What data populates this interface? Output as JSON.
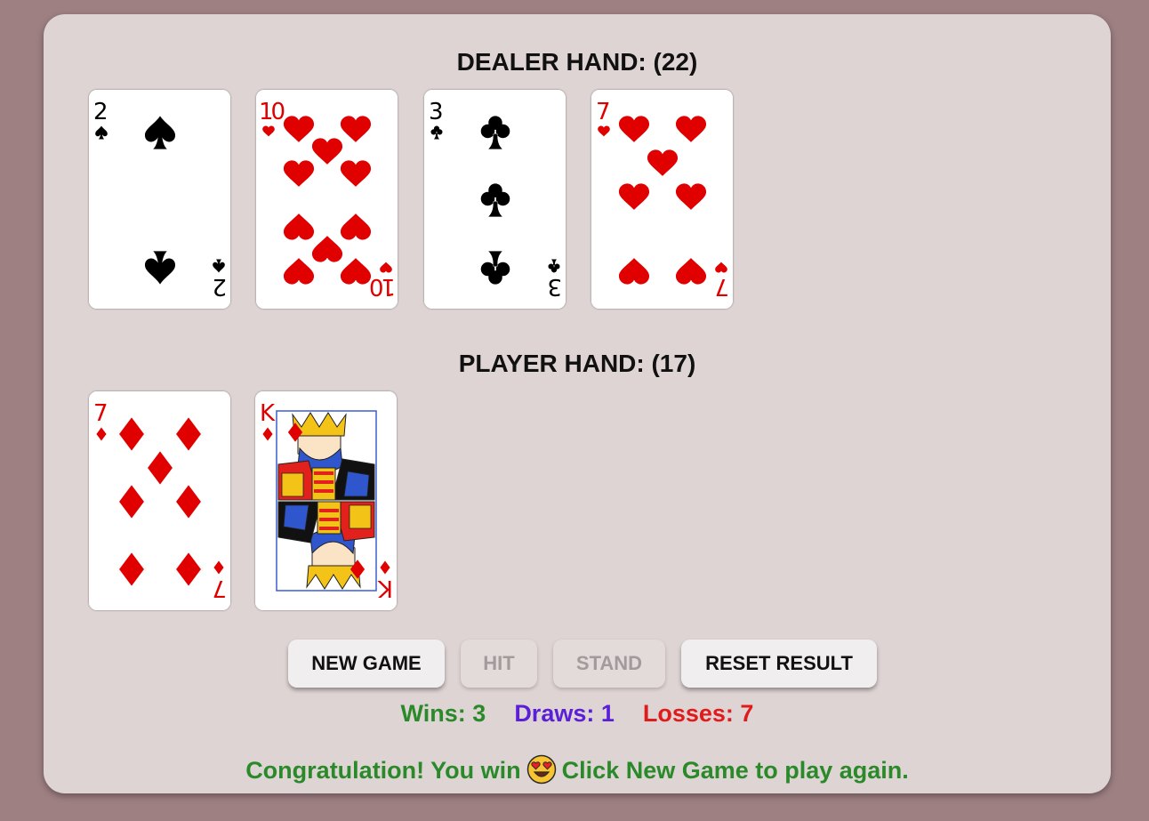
{
  "dealer": {
    "title": "DEALER HAND: (22)",
    "cards": [
      {
        "rank": "2",
        "suit": "spades"
      },
      {
        "rank": "10",
        "suit": "hearts"
      },
      {
        "rank": "3",
        "suit": "clubs"
      },
      {
        "rank": "7",
        "suit": "hearts"
      }
    ]
  },
  "player": {
    "title": "PLAYER HAND: (17)",
    "cards": [
      {
        "rank": "7",
        "suit": "diamonds"
      },
      {
        "rank": "K",
        "suit": "diamonds"
      }
    ]
  },
  "buttons": {
    "new_game": "NEW GAME",
    "hit": "HIT",
    "stand": "STAND",
    "reset": "RESET RESULT"
  },
  "score": {
    "wins": "Wins: 3",
    "draws": "Draws: 1",
    "losses": "Losses: 7"
  },
  "message": {
    "before": "Congratulation! You win",
    "emoji": "heart-eyes-emoji",
    "after": "Click New Game to play again."
  },
  "colors": {
    "background": "#9e8083",
    "panel": "#dfd4d4",
    "red_suit": "#e00000",
    "wins": "#2a8a2a",
    "draws": "#5a1fd6",
    "losses": "#e01b1b",
    "message": "#2a8a2a"
  }
}
